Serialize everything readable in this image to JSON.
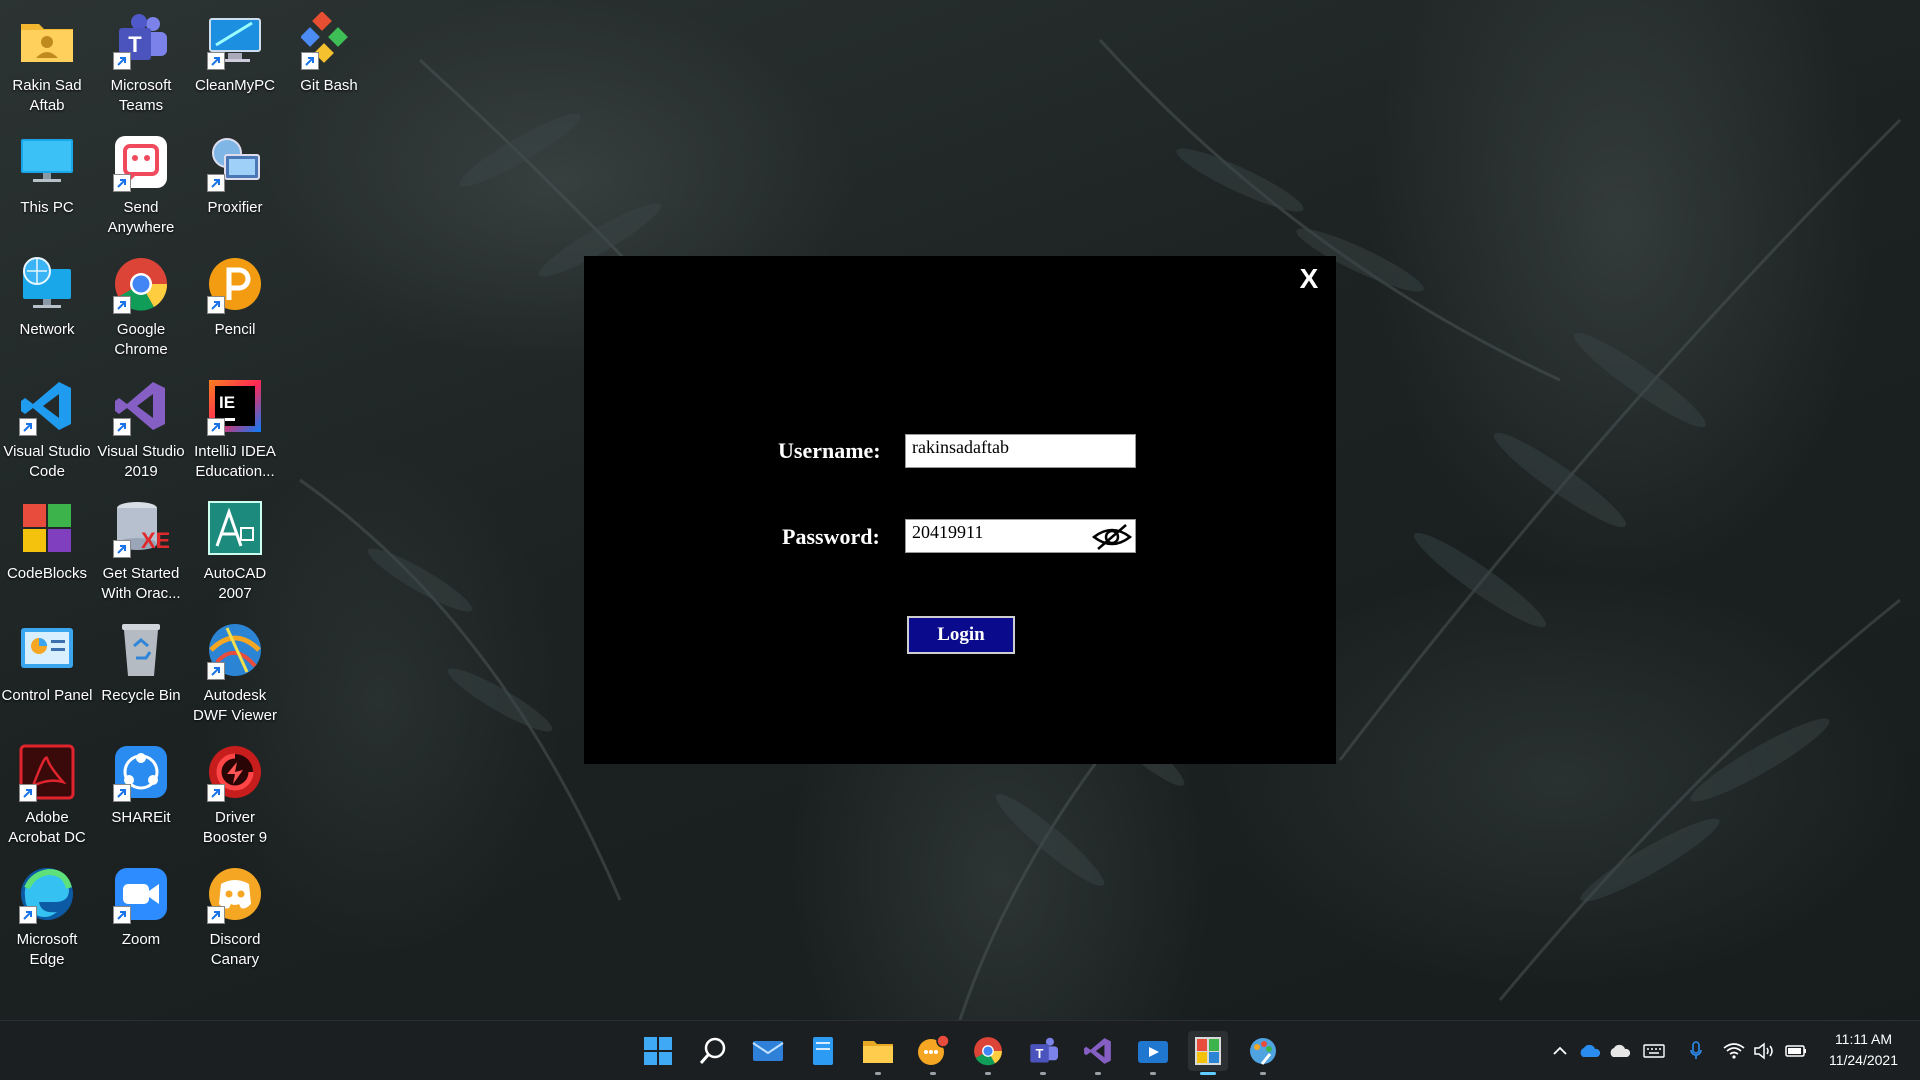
{
  "desktop": {
    "icons": [
      {
        "label": "Rakin Sad\nAftab",
        "icon": "user-folder-icon"
      },
      {
        "label": "Microsoft\nTeams",
        "icon": "teams-icon"
      },
      {
        "label": "CleanMyPC",
        "icon": "cleanmypc-icon"
      },
      {
        "label": "Git Bash",
        "icon": "git-bash-icon"
      },
      {
        "label": "This PC",
        "icon": "monitor-icon"
      },
      {
        "label": "Send\nAnywhere",
        "icon": "send-anywhere-icon"
      },
      {
        "label": "Proxifier",
        "icon": "proxifier-icon"
      },
      {
        "label": "Network",
        "icon": "network-icon"
      },
      {
        "label": "Google\nChrome",
        "icon": "chrome-icon"
      },
      {
        "label": "Pencil",
        "icon": "pencil-icon"
      },
      {
        "label": "Visual Studio\nCode",
        "icon": "vscode-icon"
      },
      {
        "label": "Visual Studio\n2019",
        "icon": "visual-studio-icon"
      },
      {
        "label": "IntelliJ IDEA\nEducation...",
        "icon": "intellij-icon"
      },
      {
        "label": "CodeBlocks",
        "icon": "codeblocks-icon"
      },
      {
        "label": "Get Started\nWith Orac...",
        "icon": "oracle-xe-icon"
      },
      {
        "label": "AutoCAD\n2007",
        "icon": "autocad-icon"
      },
      {
        "label": "Control Panel",
        "icon": "control-panel-icon"
      },
      {
        "label": "Recycle Bin",
        "icon": "recycle-bin-icon"
      },
      {
        "label": "Autodesk\nDWF Viewer",
        "icon": "dwf-viewer-icon"
      },
      {
        "label": "Adobe\nAcrobat DC",
        "icon": "acrobat-icon"
      },
      {
        "label": "SHAREit",
        "icon": "shareit-icon"
      },
      {
        "label": "Driver\nBooster 9",
        "icon": "driver-booster-icon"
      },
      {
        "label": "Microsoft\nEdge",
        "icon": "edge-icon"
      },
      {
        "label": "Zoom",
        "icon": "zoom-icon"
      },
      {
        "label": "Discord\nCanary",
        "icon": "discord-icon"
      }
    ]
  },
  "login": {
    "close_label": "X",
    "username_label": "Username:",
    "username_value": "rakinsadaftab",
    "password_label": "Password:",
    "password_value": "20419911",
    "eye_icon": "eye-slash-icon",
    "login_button": "Login"
  },
  "taskbar": {
    "apps": [
      "start-icon",
      "search-icon",
      "mail-icon",
      "notepad-icon",
      "file-explorer-icon",
      "messenger-icon",
      "chrome-icon",
      "teams-icon",
      "visual-studio-icon",
      "media-player-icon",
      "photos-app-icon",
      "paint-icon"
    ],
    "tray": [
      "chevron-up-icon",
      "onedrive-icon",
      "onedrive-personal-icon",
      "keyboard-icon",
      "microphone-icon",
      "wifi-icon",
      "volume-icon",
      "battery-icon"
    ],
    "time": "11:11 AM",
    "date": "11/24/2021"
  }
}
